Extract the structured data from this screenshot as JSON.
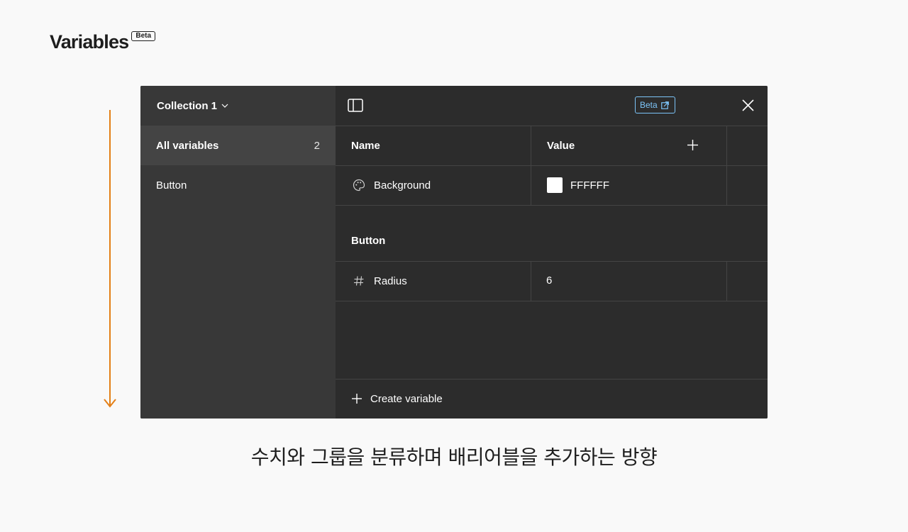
{
  "heading": {
    "title": "Variables",
    "badge": "Beta"
  },
  "colors": {
    "arrow": "#e47f16",
    "panel_bg": "#2c2c2c",
    "sidebar_bg": "#383838",
    "sidebar_active_bg": "#444444",
    "beta_link": "#7cc4f8"
  },
  "panel": {
    "collection": "Collection 1",
    "beta_label": "Beta",
    "sidebar": {
      "items": [
        {
          "label": "All variables",
          "count": "2",
          "active": true
        },
        {
          "label": "Button",
          "count": "",
          "active": false
        }
      ]
    },
    "table": {
      "columns": [
        "Name",
        "Value"
      ],
      "rows": [
        {
          "icon": "palette-icon",
          "name": "Background",
          "value": "FFFFFF",
          "swatch": "#ffffff"
        }
      ],
      "groups": [
        {
          "label": "Button",
          "rows": [
            {
              "icon": "hash-icon",
              "name": "Radius",
              "value": "6"
            }
          ]
        }
      ]
    },
    "create_label": "Create variable"
  },
  "caption": "수치와 그룹을 분류하며 배리어블을 추가하는 방향"
}
